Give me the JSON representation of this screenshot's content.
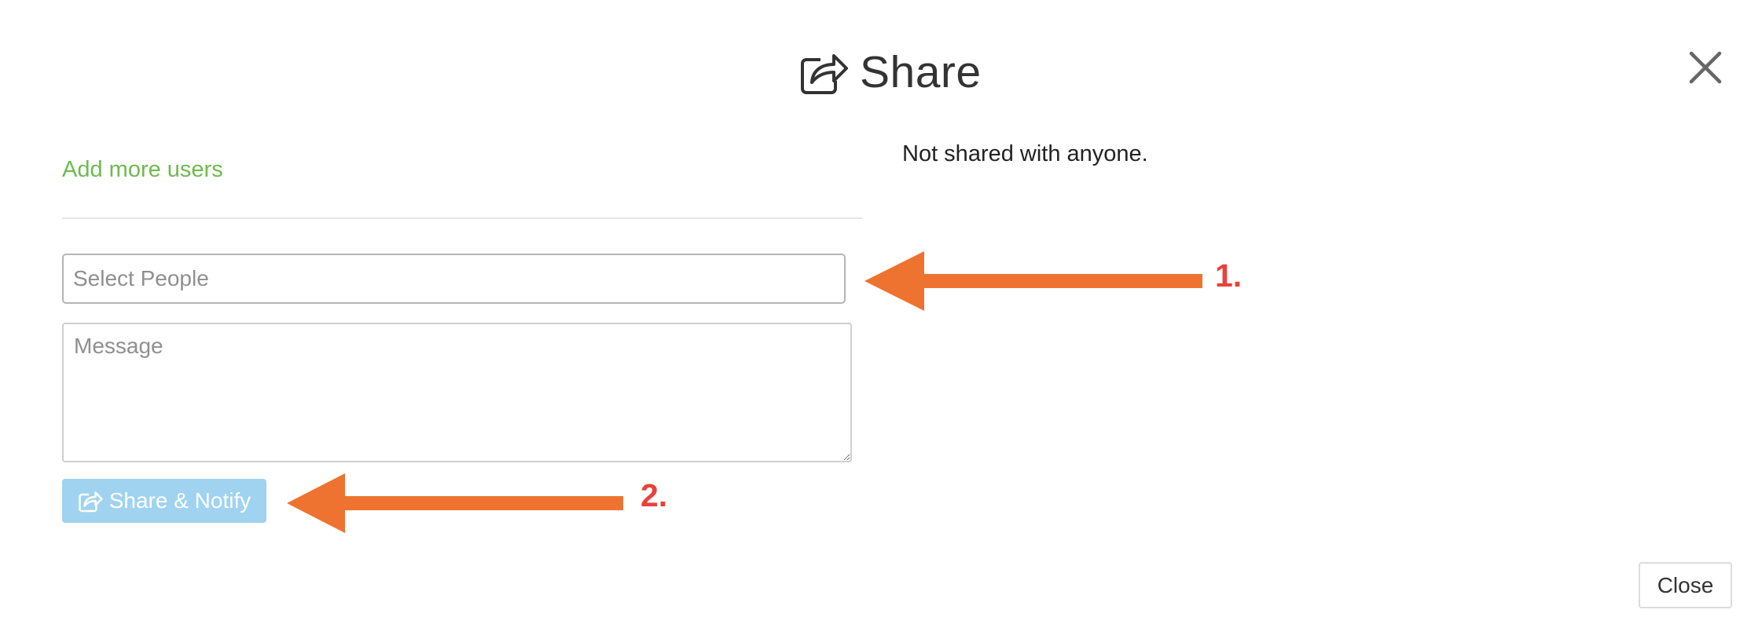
{
  "dialog": {
    "title": "Share",
    "title_icon": "share-icon",
    "close_icon": "close-icon"
  },
  "left_panel": {
    "add_more_users_link": "Add more users",
    "select_people_placeholder": "Select People",
    "message_placeholder": "Message",
    "share_notify_button": {
      "label": "Share & Notify",
      "icon": "share-icon",
      "color": "#9fd3ef"
    }
  },
  "right_panel": {
    "status_text": "Not shared with anyone."
  },
  "annotations": {
    "arrow_color": "#ee7330",
    "label_color": "#e8423b",
    "labels": [
      "1.",
      "2."
    ]
  },
  "footer": {
    "close_button": "Close"
  },
  "colors": {
    "link_green": "#6fba4f",
    "button_blue": "#9fd3ef"
  }
}
